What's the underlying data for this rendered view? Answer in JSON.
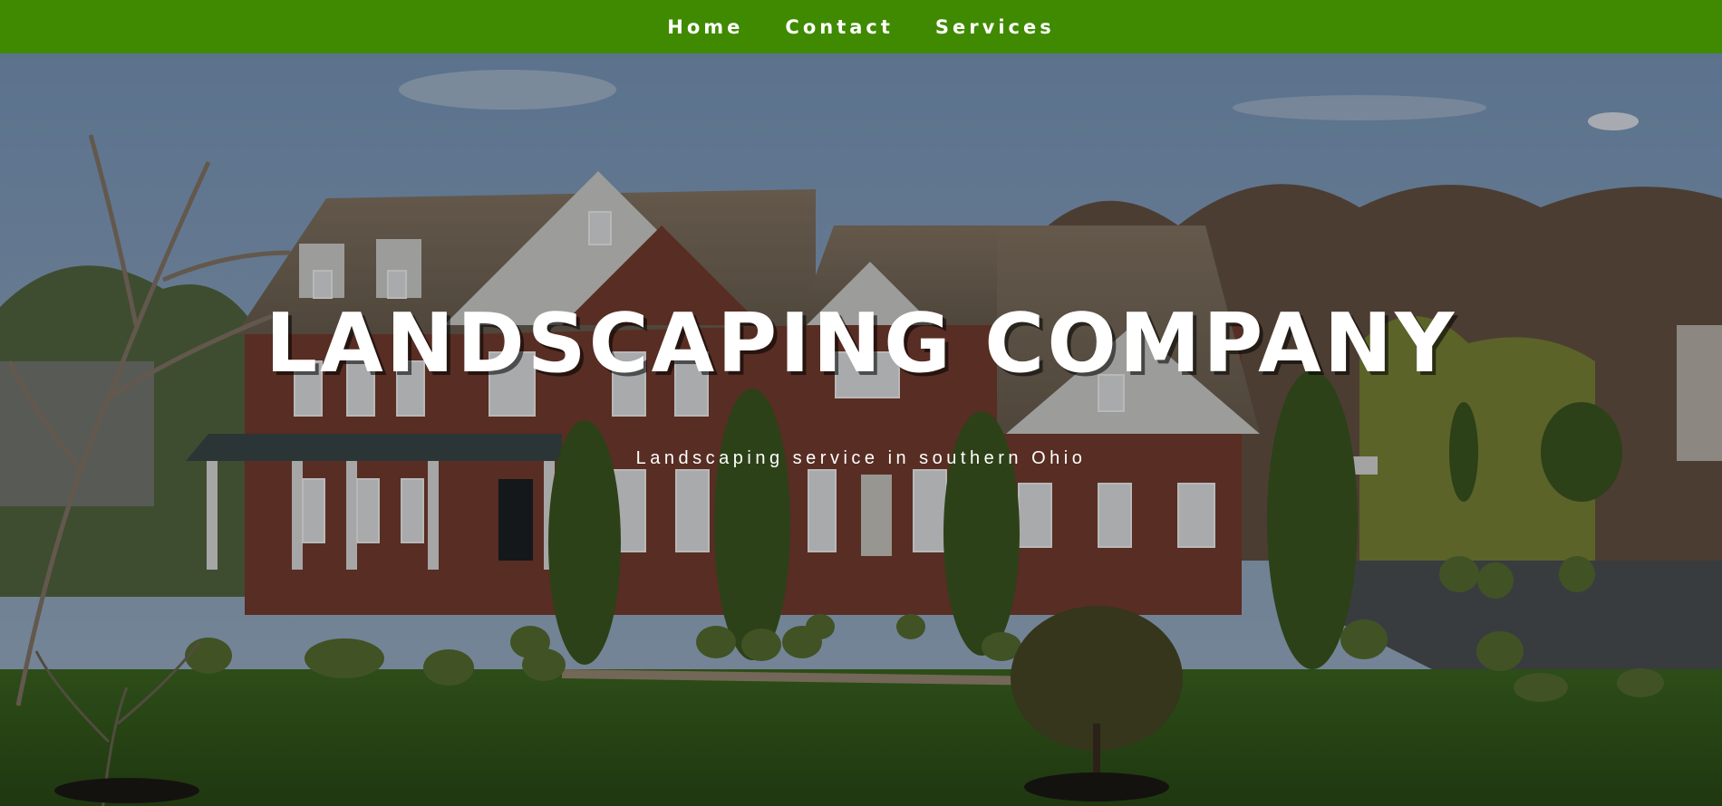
{
  "nav": {
    "items": [
      {
        "label": "Home"
      },
      {
        "label": "Contact"
      },
      {
        "label": "Services"
      }
    ]
  },
  "hero": {
    "title": "LANDSCAPING COMPANY",
    "subtitle": "Landscaping service in southern Ohio",
    "image_subject": "house-with-landscaped-lawn"
  },
  "colors": {
    "nav_background": "#3f8a00",
    "text": "#ffffff"
  }
}
